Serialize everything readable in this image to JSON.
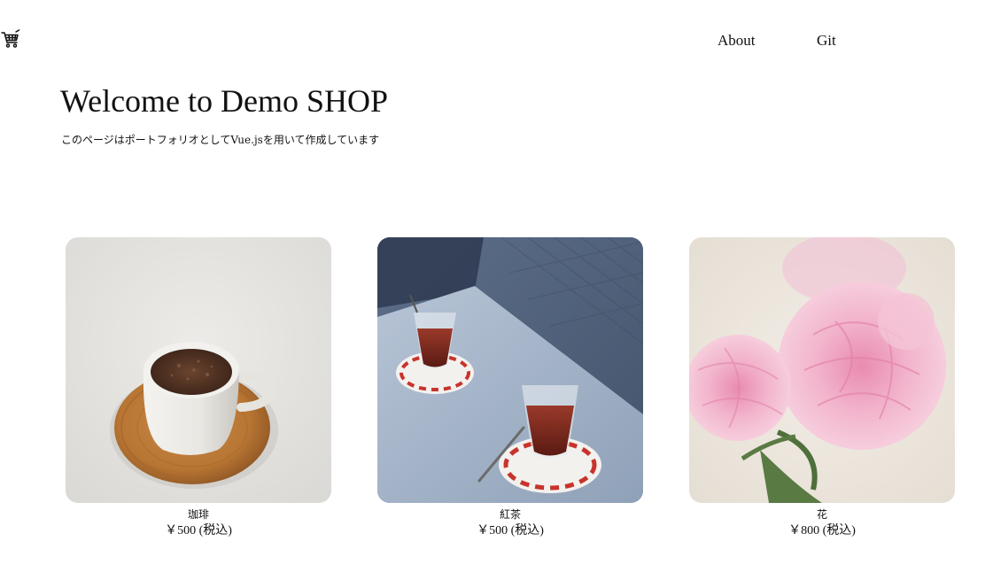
{
  "nav": {
    "about_label": "About",
    "git_label": "Git",
    "cart_icon": "cart-icon"
  },
  "hero": {
    "title": "Welcome to Demo SHOP",
    "subtitle": "このページはポートフォリオとしてVue.jsを用いて作成しています"
  },
  "products": [
    {
      "name": "珈琲",
      "price": "￥500 (税込)",
      "image_icon": "coffee-cup-photo"
    },
    {
      "name": "紅茶",
      "price": "￥500 (税込)",
      "image_icon": "tea-glasses-photo"
    },
    {
      "name": "花",
      "price": "￥800 (税込)",
      "image_icon": "peony-flowers-photo"
    }
  ]
}
